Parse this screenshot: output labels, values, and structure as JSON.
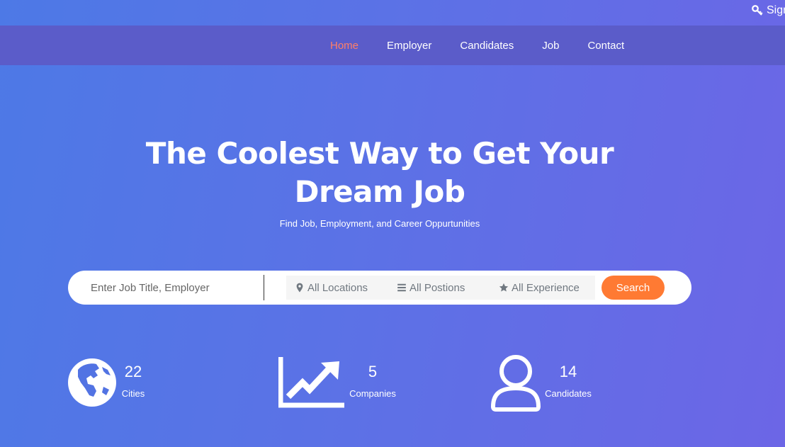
{
  "topbar": {
    "signin_label": "Sign"
  },
  "nav": {
    "items": [
      {
        "label": "Home",
        "active": true
      },
      {
        "label": "Employer"
      },
      {
        "label": "Candidates"
      },
      {
        "label": "Job"
      },
      {
        "label": "Contact"
      }
    ]
  },
  "hero": {
    "title_line1": "The Coolest Way to Get Your",
    "title_line2": "Dream Job",
    "subtitle": "Find Job, Employment, and Career Oppurtunities"
  },
  "search": {
    "placeholder": "Enter Job Title, Employer",
    "value": "",
    "filters": [
      {
        "label": "All Locations",
        "icon": "map-marker-icon"
      },
      {
        "label": "All Postions",
        "icon": "list-icon"
      },
      {
        "label": "All Experience",
        "icon": "star-icon"
      }
    ],
    "button_label": "Search",
    "button_color": "#ff7a33"
  },
  "stats": [
    {
      "value": "22",
      "label": "Cities",
      "icon": "globe-icon"
    },
    {
      "value": "5",
      "label": "Companies",
      "icon": "trend-chart-icon"
    },
    {
      "value": "14",
      "label": "Candidates",
      "icon": "user-icon"
    }
  ],
  "colors": {
    "navbar": "#5b5cc9",
    "active_nav": "#ff7f67",
    "accent": "#ff7a33"
  }
}
